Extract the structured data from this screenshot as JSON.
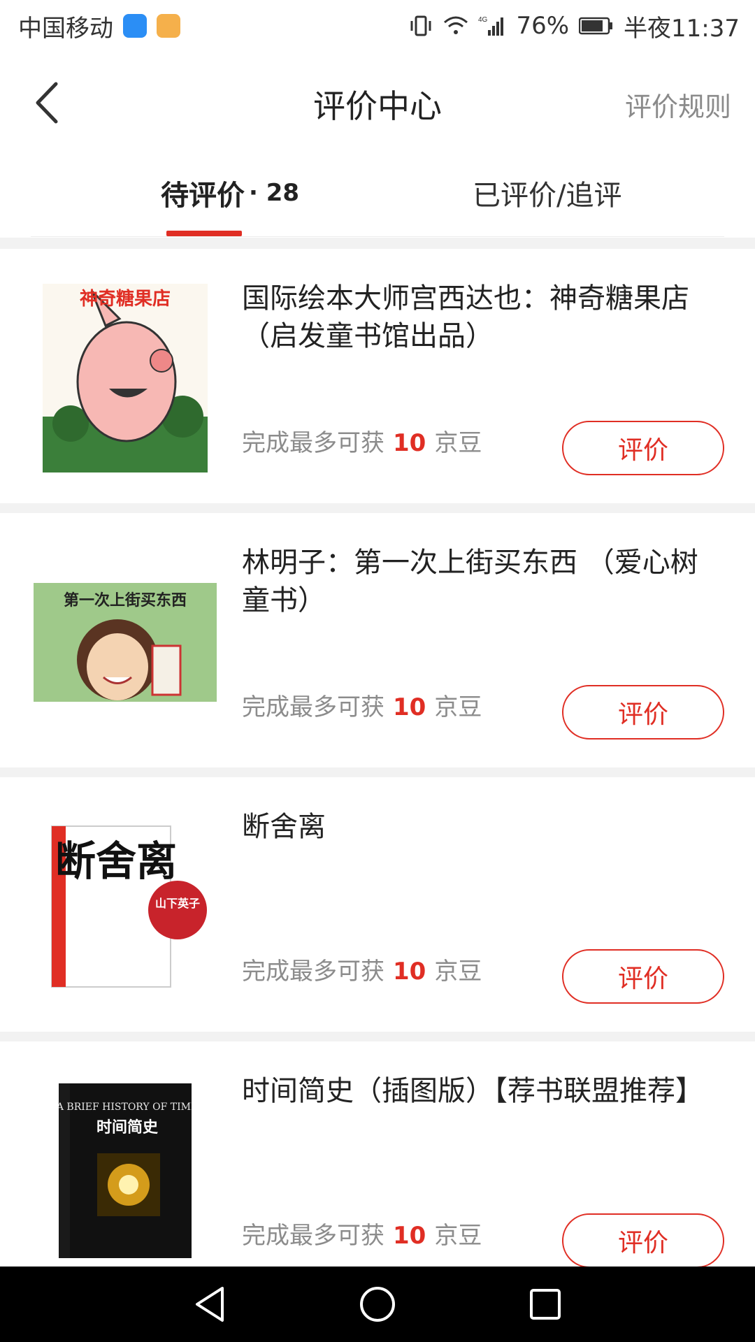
{
  "status_bar": {
    "carrier": "中国移动",
    "battery": "76%",
    "time": "半夜11:37",
    "network": "4G",
    "icons": [
      "vibrate-icon",
      "wifi-icon",
      "signal-icon",
      "battery-icon"
    ]
  },
  "header": {
    "title": "评价中心",
    "rules_label": "评价规则"
  },
  "tabs": {
    "pending_label": "待评价",
    "pending_count": "· 28",
    "reviewed_label": "已评价/追评"
  },
  "products": [
    {
      "title": "国际绘本大师宫西达也：神奇糖果店（启发童书馆出品）",
      "cover_text": "神奇糖果店",
      "reward_prefix": "完成最多可获",
      "reward_num": "10",
      "reward_unit": "京豆",
      "button": "评价"
    },
    {
      "title": "林明子：第一次上街买东西 （爱心树童书）",
      "cover_text": "第一次上街买东西",
      "reward_prefix": "完成最多可获",
      "reward_num": "10",
      "reward_unit": "京豆",
      "button": "评价"
    },
    {
      "title": "断舍离",
      "cover_text": "断舍离",
      "cover_badge": "山下英子",
      "reward_prefix": "完成最多可获",
      "reward_num": "10",
      "reward_unit": "京豆",
      "button": "评价"
    },
    {
      "title": "时间简史（插图版）【荐书联盟推荐】",
      "cover_text": "A BRIEF HISTORY OF TIME",
      "cover_subtext": "时间简史",
      "reward_prefix": "完成最多可获",
      "reward_num": "10",
      "reward_unit": "京豆",
      "button": "评价"
    }
  ],
  "colors": {
    "accent": "#e02e24",
    "background": "#f2f2f2"
  }
}
